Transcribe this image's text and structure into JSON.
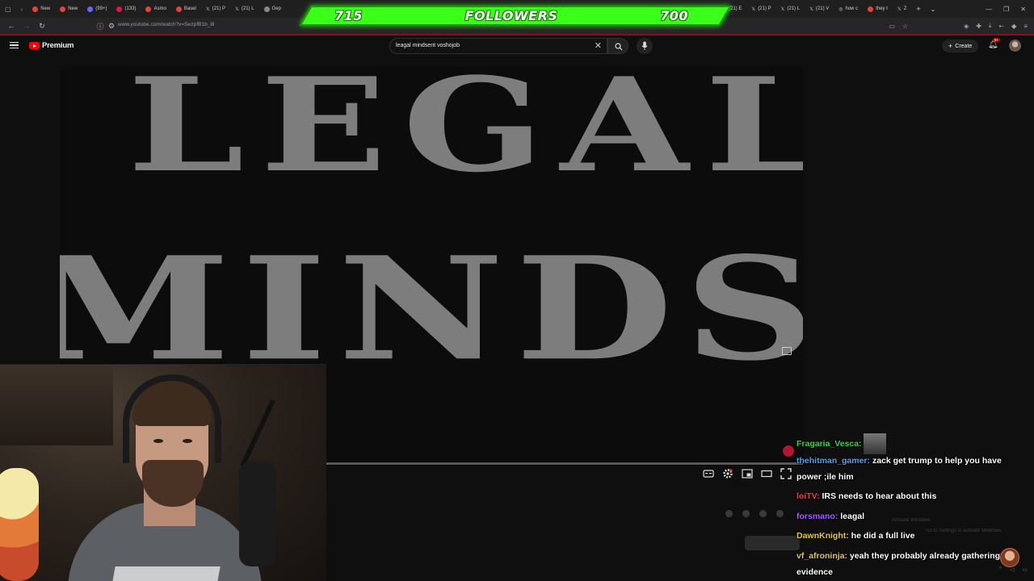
{
  "browser": {
    "tabs": [
      {
        "label": "New",
        "color": "#e0453a"
      },
      {
        "label": "New",
        "color": "#e0453a"
      },
      {
        "label": "(99+)",
        "color": "#6b63ff"
      },
      {
        "label": "(133)",
        "color": "#d81a3c"
      },
      {
        "label": "Asmo",
        "color": "#e0453a"
      },
      {
        "label": "Basel",
        "color": "#e0453a"
      },
      {
        "label": "(21) P",
        "color": "#cccccc"
      },
      {
        "label": "(21) L",
        "color": "#cccccc"
      },
      {
        "label": "Gep",
        "color": "#cccccc"
      }
    ],
    "tabs_right": [
      {
        "label": "(21) E",
        "color": "#cccccc"
      },
      {
        "label": "(21) P",
        "color": "#cccccc"
      },
      {
        "label": "(21) L",
        "color": "#cccccc"
      },
      {
        "label": "(21) V",
        "color": "#cccccc"
      },
      {
        "label": "how c",
        "color": "#cccccc"
      },
      {
        "label": "they t",
        "color": "#cccccc"
      },
      {
        "label": "Z",
        "color": "#cccccc"
      }
    ],
    "url": "www.youtube.com/watch?v=5wzpfB1b_l8"
  },
  "overlay": {
    "followers_current": "715",
    "followers_label": "FOLLOWERS",
    "followers_goal": "700",
    "accent": "#3bff1a"
  },
  "youtube": {
    "brand": "Premium",
    "search_value": "leagal mindsent voshojob",
    "create_label": "Create",
    "notif_count": "9+"
  },
  "video": {
    "line1": "LEGAL",
    "line2": "MINDSET"
  },
  "chat": {
    "messages": [
      {
        "user": "Fragaria_Vesca:",
        "color": "#3fd14a",
        "text": "",
        "emote": true
      },
      {
        "user": "thehitman_gamer:",
        "color": "#4aa3ff",
        "text": " zack get trump to help you have power ;ile him"
      },
      {
        "user": "loiTV:",
        "color": "#ff3c3c",
        "text": " IRS needs to hear about this"
      },
      {
        "user": "forsmano:",
        "color": "#a95cff",
        "text": " leagal"
      },
      {
        "user": "DawnKnight:",
        "color": "#e6c84a",
        "text": " he did a full live"
      },
      {
        "user": "vf_afroninja:",
        "color": "#e6c84a",
        "text": " yeah they probably already gathering evidence"
      }
    ],
    "faint_1": "Activate Windows",
    "faint_2": "Go to Settings to activate Windows."
  }
}
